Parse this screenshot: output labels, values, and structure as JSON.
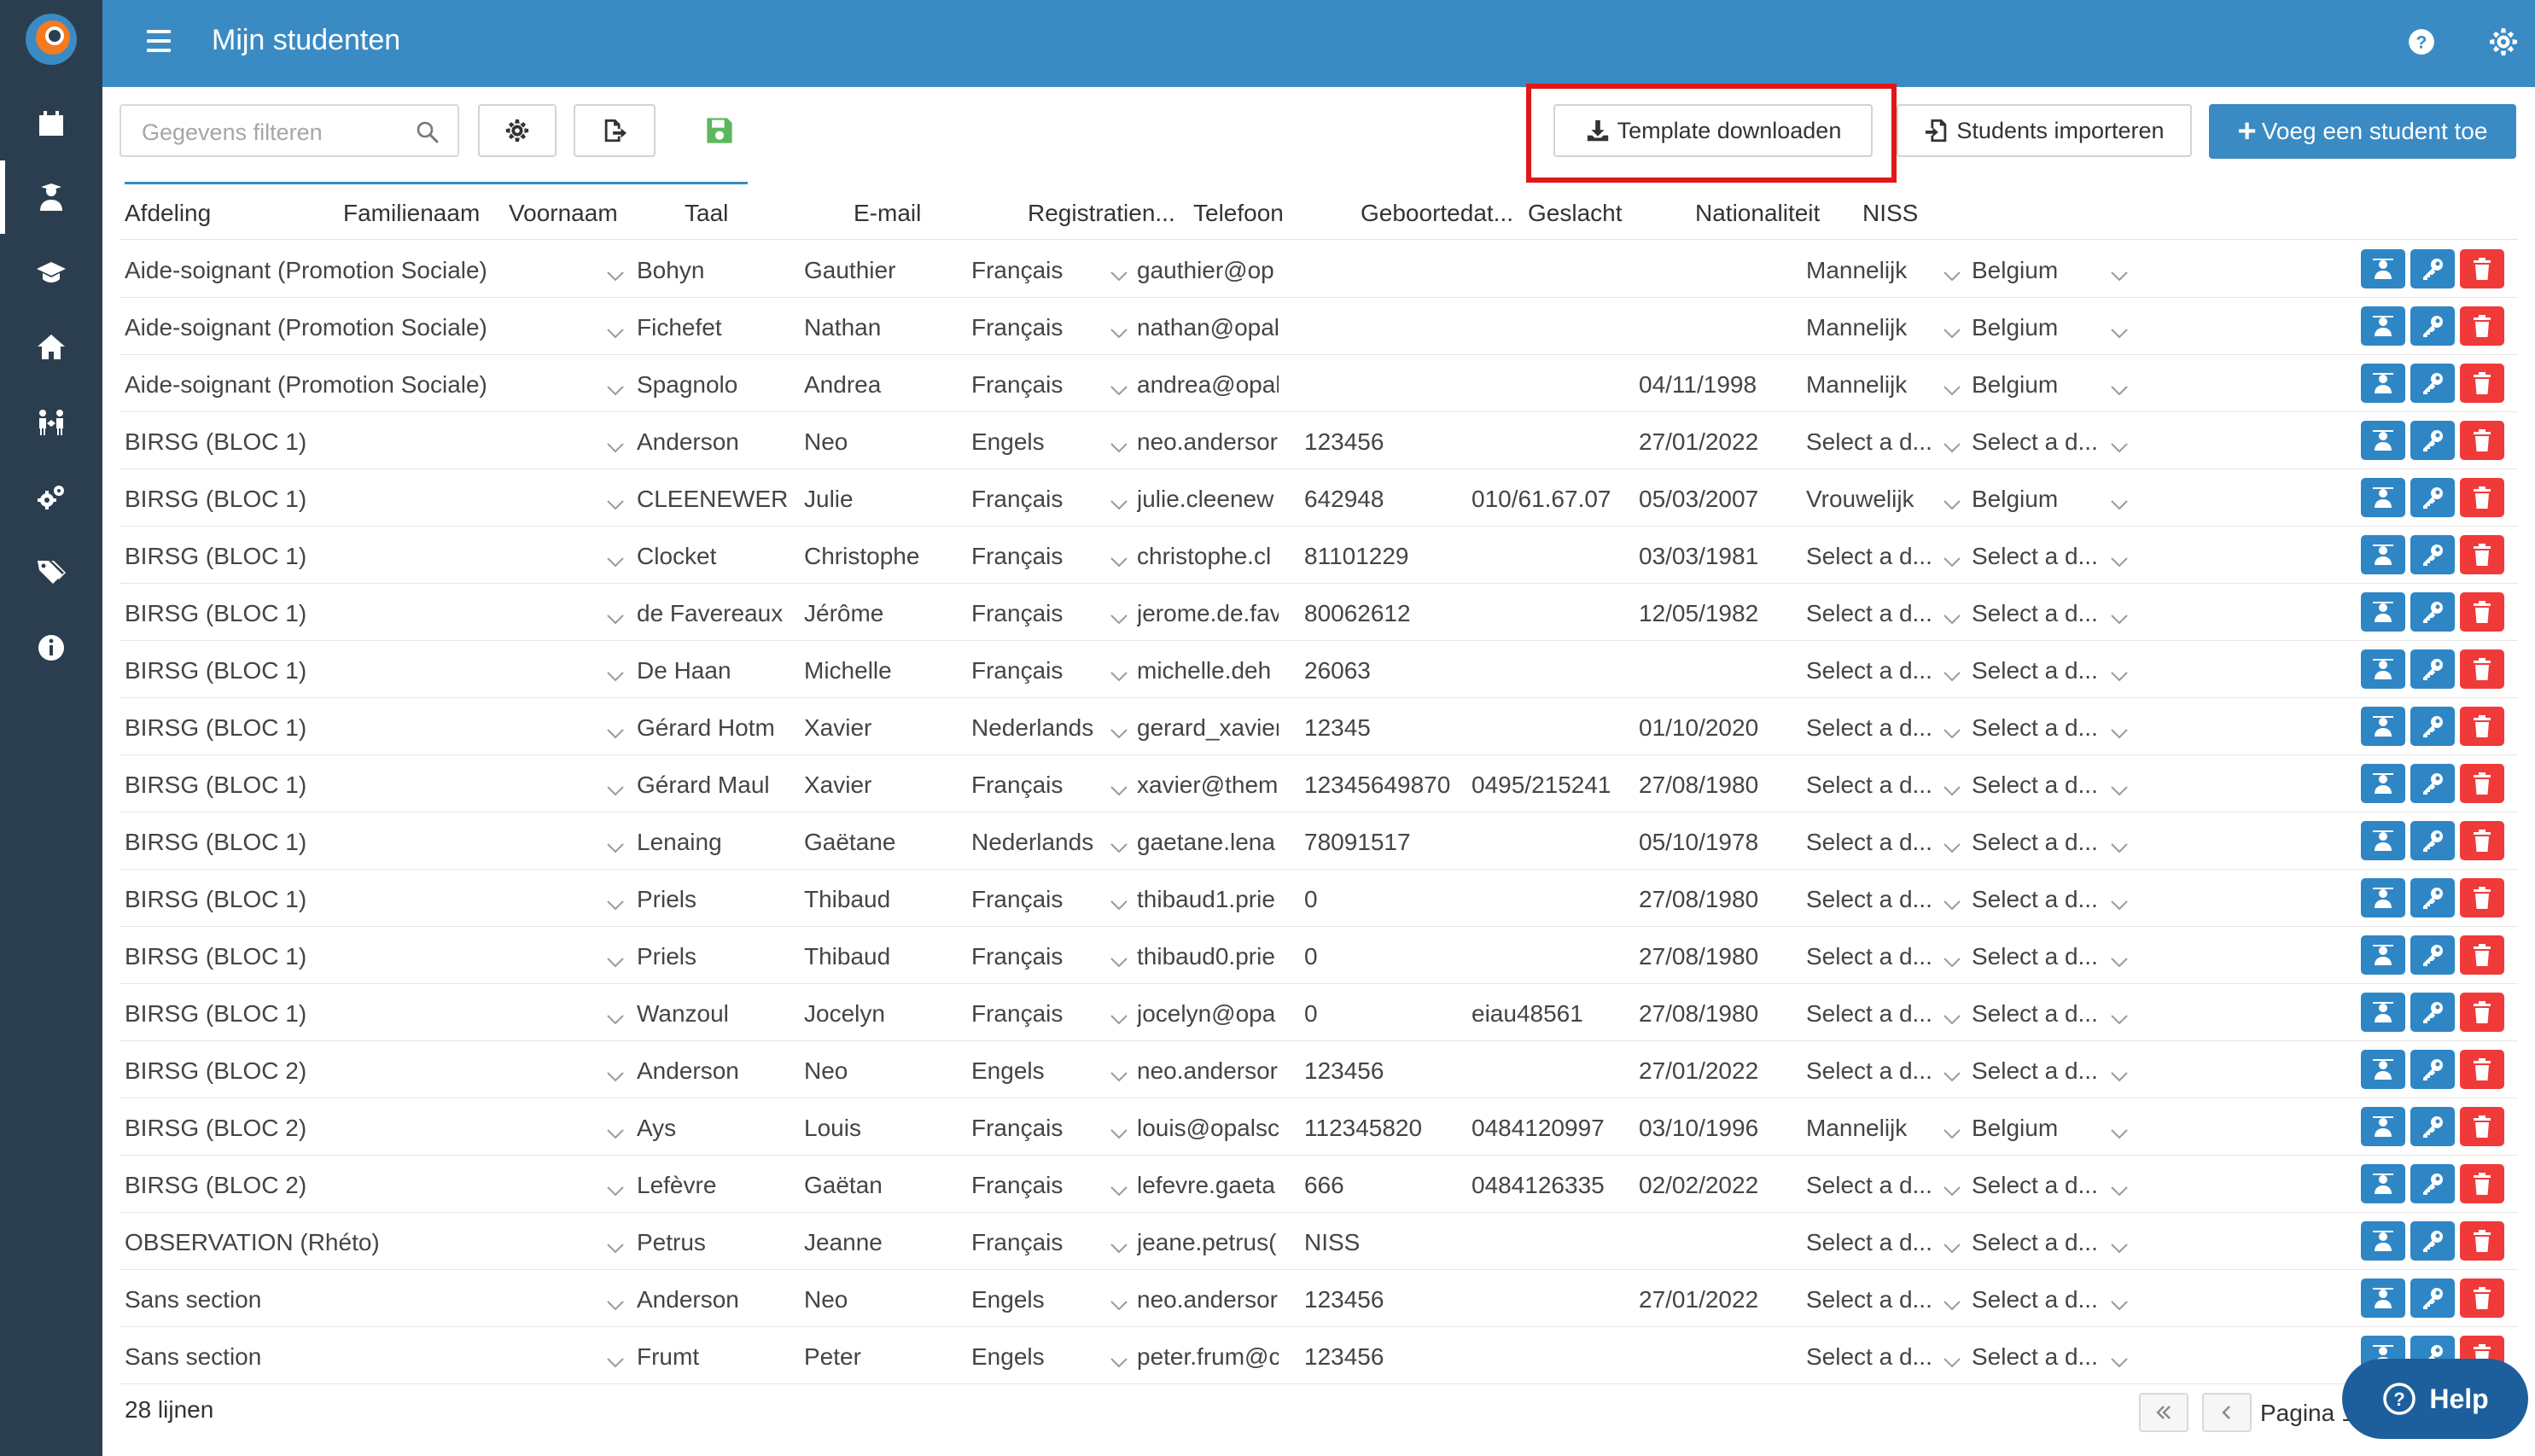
{
  "app": {
    "title": "Mijn studenten",
    "colors": {
      "topbar": "#3a8bc4",
      "rail": "#2b3e4f",
      "primary": "#3a8bc4",
      "danger": "#f03a3a",
      "highlight": "#e01818",
      "save": "#5cb85c"
    }
  },
  "sidebar": {
    "items": [
      {
        "icon": "calendar-icon"
      },
      {
        "icon": "student-icon",
        "active": true
      },
      {
        "icon": "graduation-cap-icon"
      },
      {
        "icon": "home-icon"
      },
      {
        "icon": "people-arrows-icon"
      },
      {
        "icon": "cogs-icon"
      },
      {
        "icon": "tags-icon"
      },
      {
        "icon": "info-icon"
      }
    ]
  },
  "toolbar": {
    "search_placeholder": "Gegevens filteren",
    "template_label": "Template downloaden",
    "import_label": "Students importeren",
    "add_label": "Voeg een student toe"
  },
  "table": {
    "columns": [
      "Afdeling",
      "Familienaam",
      "Voornaam",
      "Taal",
      "E-mail",
      "Registratien...",
      "Telefoon",
      "Geboortedat...",
      "Geslacht",
      "Nationaliteit",
      "NISS"
    ],
    "rows": [
      {
        "afdeling": "Aide-soignant (Promotion Sociale)",
        "familienaam": "Bohyn",
        "voornaam": "Gauthier",
        "taal": "Français",
        "email": "gauthier@op",
        "registratie": "",
        "telefoon": "",
        "geboorte": "",
        "geslacht": "Mannelijk",
        "nationaliteit": "Belgium",
        "niss": ""
      },
      {
        "afdeling": "Aide-soignant (Promotion Sociale)",
        "familienaam": "Fichefet",
        "voornaam": "Nathan",
        "taal": "Français",
        "email": "nathan@opal",
        "registratie": "",
        "telefoon": "",
        "geboorte": "",
        "geslacht": "Mannelijk",
        "nationaliteit": "Belgium",
        "niss": ""
      },
      {
        "afdeling": "Aide-soignant (Promotion Sociale)",
        "familienaam": "Spagnolo",
        "voornaam": "Andrea",
        "taal": "Français",
        "email": "andrea@opal",
        "registratie": "",
        "telefoon": "",
        "geboorte": "04/11/1998",
        "geslacht": "Mannelijk",
        "nationaliteit": "Belgium",
        "niss": ""
      },
      {
        "afdeling": "BIRSG (BLOC 1)",
        "familienaam": "Anderson",
        "voornaam": "Neo",
        "taal": "Engels",
        "email": "neo.andersor",
        "registratie": "123456",
        "telefoon": "",
        "geboorte": "27/01/2022",
        "geslacht": "Select a d...",
        "nationaliteit": "Select a d...",
        "niss": ""
      },
      {
        "afdeling": "BIRSG (BLOC 1)",
        "familienaam": "CLEENEWER",
        "voornaam": "Julie",
        "taal": "Français",
        "email": "julie.cleenew",
        "registratie": "642948",
        "telefoon": "010/61.67.07",
        "geboorte": "05/03/2007",
        "geslacht": "Vrouwelijk",
        "nationaliteit": "Belgium",
        "niss": ""
      },
      {
        "afdeling": "BIRSG (BLOC 1)",
        "familienaam": "Clocket",
        "voornaam": "Christophe",
        "taal": "Français",
        "email": "christophe.cl",
        "registratie": "81101229",
        "telefoon": "",
        "geboorte": "03/03/1981",
        "geslacht": "Select a d...",
        "nationaliteit": "Select a d...",
        "niss": ""
      },
      {
        "afdeling": "BIRSG (BLOC 1)",
        "familienaam": "de Favereaux",
        "voornaam": "Jérôme",
        "taal": "Français",
        "email": "jerome.de.fav",
        "registratie": "80062612",
        "telefoon": "",
        "geboorte": "12/05/1982",
        "geslacht": "Select a d...",
        "nationaliteit": "Select a d...",
        "niss": ""
      },
      {
        "afdeling": "BIRSG (BLOC 1)",
        "familienaam": "De Haan",
        "voornaam": "Michelle",
        "taal": "Français",
        "email": "michelle.deh",
        "registratie": "26063",
        "telefoon": "",
        "geboorte": "",
        "geslacht": "Select a d...",
        "nationaliteit": "Select a d...",
        "niss": ""
      },
      {
        "afdeling": "BIRSG (BLOC 1)",
        "familienaam": "Gérard Hotm",
        "voornaam": "Xavier",
        "taal": "Nederlands",
        "email": "gerard_xavier",
        "registratie": "12345",
        "telefoon": "",
        "geboorte": "01/10/2020",
        "geslacht": "Select a d...",
        "nationaliteit": "Select a d...",
        "niss": ""
      },
      {
        "afdeling": "BIRSG (BLOC 1)",
        "familienaam": "Gérard Maul",
        "voornaam": "Xavier",
        "taal": "Français",
        "email": "xavier@them",
        "registratie": "12345649870",
        "telefoon": "0495/215241",
        "geboorte": "27/08/1980",
        "geslacht": "Select a d...",
        "nationaliteit": "Select a d...",
        "niss": ""
      },
      {
        "afdeling": "BIRSG (BLOC 1)",
        "familienaam": "Lenaing",
        "voornaam": "Gaëtane",
        "taal": "Nederlands",
        "email": "gaetane.lena",
        "registratie": "78091517",
        "telefoon": "",
        "geboorte": "05/10/1978",
        "geslacht": "Select a d...",
        "nationaliteit": "Select a d...",
        "niss": ""
      },
      {
        "afdeling": "BIRSG (BLOC 1)",
        "familienaam": "Priels",
        "voornaam": "Thibaud",
        "taal": "Français",
        "email": "thibaud1.prie",
        "registratie": "0",
        "telefoon": "",
        "geboorte": "27/08/1980",
        "geslacht": "Select a d...",
        "nationaliteit": "Select a d...",
        "niss": ""
      },
      {
        "afdeling": "BIRSG (BLOC 1)",
        "familienaam": "Priels",
        "voornaam": "Thibaud",
        "taal": "Français",
        "email": "thibaud0.prie",
        "registratie": "0",
        "telefoon": "",
        "geboorte": "27/08/1980",
        "geslacht": "Select a d...",
        "nationaliteit": "Select a d...",
        "niss": ""
      },
      {
        "afdeling": "BIRSG (BLOC 1)",
        "familienaam": "Wanzoul",
        "voornaam": "Jocelyn",
        "taal": "Français",
        "email": "jocelyn@opa",
        "registratie": "0",
        "telefoon": "eiau48561",
        "geboorte": "27/08/1980",
        "geslacht": "Select a d...",
        "nationaliteit": "Select a d...",
        "niss": ""
      },
      {
        "afdeling": "BIRSG (BLOC 2)",
        "familienaam": "Anderson",
        "voornaam": "Neo",
        "taal": "Engels",
        "email": "neo.andersor",
        "registratie": "123456",
        "telefoon": "",
        "geboorte": "27/01/2022",
        "geslacht": "Select a d...",
        "nationaliteit": "Select a d...",
        "niss": ""
      },
      {
        "afdeling": "BIRSG (BLOC 2)",
        "familienaam": "Ays",
        "voornaam": "Louis",
        "taal": "Français",
        "email": "louis@opalsc",
        "registratie": "112345820",
        "telefoon": "0484120997",
        "geboorte": "03/10/1996",
        "geslacht": "Mannelijk",
        "nationaliteit": "Belgium",
        "niss": ""
      },
      {
        "afdeling": "BIRSG (BLOC 2)",
        "familienaam": "Lefèvre",
        "voornaam": "Gaëtan",
        "taal": "Français",
        "email": "lefevre.gaeta",
        "registratie": "666",
        "telefoon": "0484126335",
        "geboorte": "02/02/2022",
        "geslacht": "Select a d...",
        "nationaliteit": "Select a d...",
        "niss": ""
      },
      {
        "afdeling": "OBSERVATION (Rhéto)",
        "familienaam": "Petrus",
        "voornaam": "Jeanne",
        "taal": "Français",
        "email": "jeane.petrus(",
        "registratie": "NISS",
        "telefoon": "",
        "geboorte": "",
        "geslacht": "Select a d...",
        "nationaliteit": "Select a d...",
        "niss": ""
      },
      {
        "afdeling": "Sans section",
        "familienaam": "Anderson",
        "voornaam": "Neo",
        "taal": "Engels",
        "email": "neo.andersor",
        "registratie": "123456",
        "telefoon": "",
        "geboorte": "27/01/2022",
        "geslacht": "Select a d...",
        "nationaliteit": "Select a d...",
        "niss": ""
      },
      {
        "afdeling": "Sans section",
        "familienaam": "Frumt",
        "voornaam": "Peter",
        "taal": "Engels",
        "email": "peter.frum@c",
        "registratie": "123456",
        "telefoon": "",
        "geboorte": "",
        "geslacht": "Select a d...",
        "nationaliteit": "Select a d...",
        "niss": ""
      }
    ]
  },
  "footer": {
    "row_count": "28 lijnen",
    "page_label": "Pagina 1",
    "help_label": "Help"
  }
}
